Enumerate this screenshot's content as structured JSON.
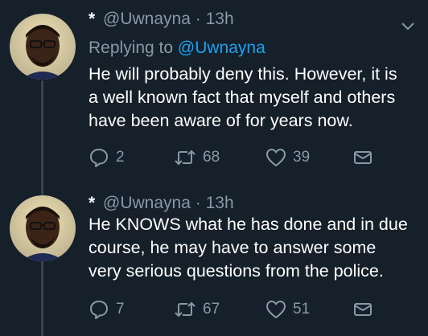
{
  "tweets": [
    {
      "star": "*",
      "handle": "@Uwnayna",
      "separator": "·",
      "time": "13h",
      "replying_prefix": "Replying to",
      "replying_to": "@Uwnayna",
      "text_lines": [
        "He will probably deny this. However, it is",
        "a well known fact that myself and others",
        "have been aware of for years now."
      ],
      "replies": "2",
      "retweets": "68",
      "likes": "39"
    },
    {
      "star": "*",
      "handle": "@Uwnayna",
      "separator": "·",
      "time": "13h",
      "text_lines": [
        "He KNOWS what he has done and in due",
        "course, he may have to answer some",
        "very serious questions from the police."
      ],
      "replies": "7",
      "retweets": "67",
      "likes": "51"
    }
  ],
  "icons": {
    "reply": "speech-bubble-icon",
    "retweet": "retweet-arrows-icon",
    "like": "heart-outline-icon",
    "dm": "envelope-icon",
    "caret": "chevron-down-icon"
  },
  "colors": {
    "background": "#15202b",
    "text": "#ffffff",
    "muted": "#8899a6",
    "link": "#1da1f2",
    "thread_line": "#38444d"
  }
}
